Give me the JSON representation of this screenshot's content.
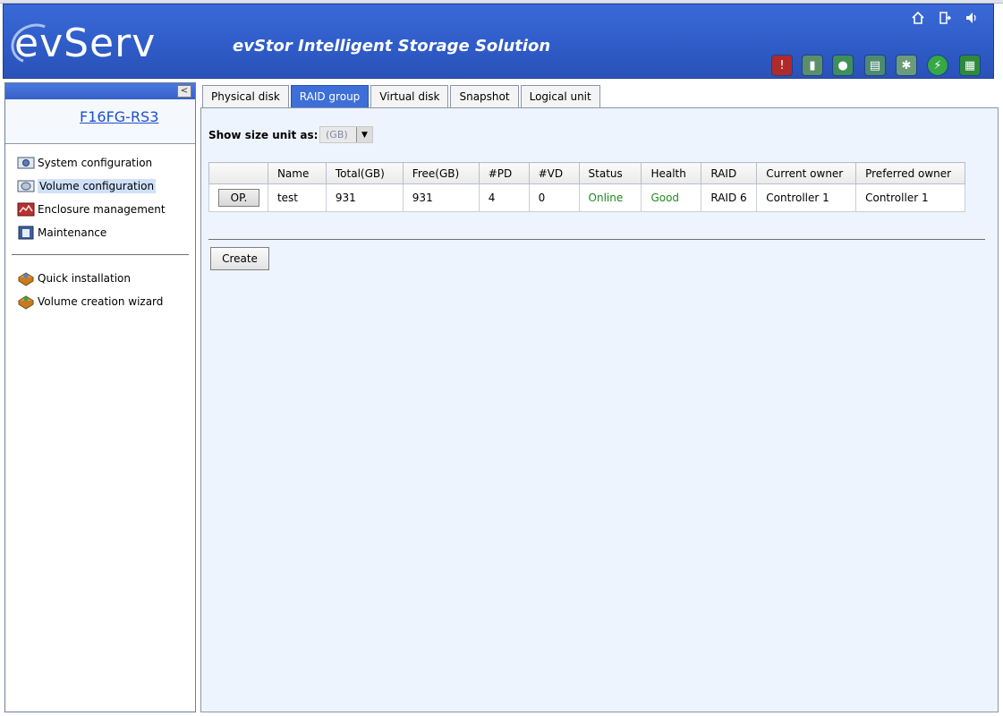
{
  "header": {
    "logo": "evServ",
    "product_title": "evStor Intelligent Storage Solution",
    "top_icons": [
      "home-icon",
      "logout-icon",
      "sound-icon"
    ],
    "status_icons": [
      "disk-warning-icon",
      "battery-icon",
      "network-icon",
      "memory-icon",
      "fan-icon",
      "power-icon",
      "board-icon"
    ]
  },
  "sidebar": {
    "host": "F16FG-RS3",
    "collapse_glyph": "<",
    "items": [
      {
        "label": "System configuration",
        "icon": "system-config-icon"
      },
      {
        "label": "Volume configuration",
        "icon": "volume-config-icon",
        "selected": true
      },
      {
        "label": "Enclosure management",
        "icon": "enclosure-icon"
      },
      {
        "label": "Maintenance",
        "icon": "maintenance-icon"
      }
    ],
    "wizards": [
      {
        "label": "Quick installation",
        "icon": "quick-install-icon"
      },
      {
        "label": "Volume creation wizard",
        "icon": "volume-wizard-icon"
      }
    ]
  },
  "tabs": [
    {
      "label": "Physical disk"
    },
    {
      "label": "RAID group",
      "active": true
    },
    {
      "label": "Virtual disk"
    },
    {
      "label": "Snapshot"
    },
    {
      "label": "Logical unit"
    }
  ],
  "main": {
    "size_label": "Show size unit as:",
    "size_value": "(GB)",
    "columns": [
      "",
      "Name",
      "Total(GB)",
      "Free(GB)",
      "#PD",
      "#VD",
      "Status",
      "Health",
      "RAID",
      "Current owner",
      "Preferred owner"
    ],
    "rows": [
      {
        "op": "OP.",
        "name": "test",
        "total": "931",
        "free": "931",
        "pd": "4",
        "vd": "0",
        "status": "Online",
        "health": "Good",
        "raid": "RAID 6",
        "current_owner": "Controller 1",
        "preferred_owner": "Controller 1"
      }
    ],
    "create_label": "Create"
  },
  "colors": {
    "header_blue": "#2f5cc8",
    "tab_active": "#3e6fd8",
    "status_green": "#1e8a1e",
    "link_blue": "#1b4fd0"
  }
}
